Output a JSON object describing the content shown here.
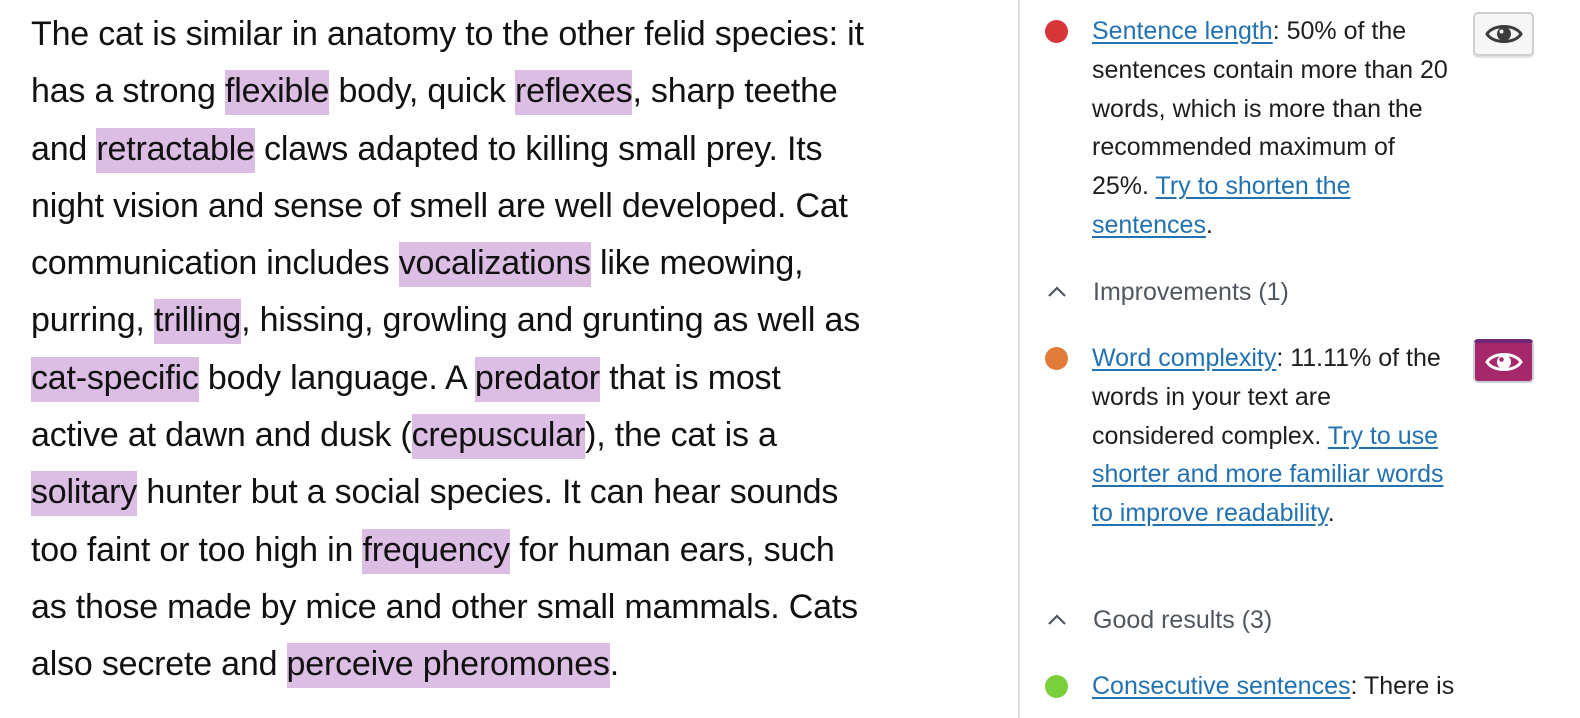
{
  "editor": {
    "highlight_color": "#dcbde4",
    "lines": [
      [
        {
          "t": "The cat is similar in anatomy to the other felid species: it",
          "h": false
        }
      ],
      [
        {
          "t": "has a strong ",
          "h": false
        },
        {
          "t": "flexible",
          "h": true
        },
        {
          "t": " body, quick ",
          "h": false
        },
        {
          "t": "reflexes",
          "h": true
        },
        {
          "t": ", sharp teethe",
          "h": false
        }
      ],
      [
        {
          "t": "and ",
          "h": false
        },
        {
          "t": "retractable",
          "h": true
        },
        {
          "t": " claws adapted to killing small prey. Its",
          "h": false
        }
      ],
      [
        {
          "t": "night vision and sense of smell are well developed. Cat",
          "h": false
        }
      ],
      [
        {
          "t": "communication includes ",
          "h": false
        },
        {
          "t": "vocalizations",
          "h": true
        },
        {
          "t": " like meowing,",
          "h": false
        }
      ],
      [
        {
          "t": "purring, ",
          "h": false
        },
        {
          "t": "trilling",
          "h": true
        },
        {
          "t": ", hissing, growling and grunting as well as",
          "h": false
        }
      ],
      [
        {
          "t": "cat-specific",
          "h": true
        },
        {
          "t": " body language. A ",
          "h": false
        },
        {
          "t": "predator",
          "h": true
        },
        {
          "t": " that is most",
          "h": false
        }
      ],
      [
        {
          "t": "active at dawn and dusk (",
          "h": false
        },
        {
          "t": "crepuscular",
          "h": true
        },
        {
          "t": "), the cat is a",
          "h": false
        }
      ],
      [
        {
          "t": "solitary",
          "h": true
        },
        {
          "t": " hunter but a social species. It can hear sounds",
          "h": false
        }
      ],
      [
        {
          "t": "too faint or too high in ",
          "h": false
        },
        {
          "t": "frequency",
          "h": true
        },
        {
          "t": " for human ears, such",
          "h": false
        }
      ],
      [
        {
          "t": "as those made by mice and other small mammals. Cats",
          "h": false
        }
      ],
      [
        {
          "t": "also secrete and ",
          "h": false
        },
        {
          "t": "perceive pheromones",
          "h": true
        },
        {
          "t": ".",
          "h": false
        }
      ]
    ]
  },
  "sidebar": {
    "problems": {
      "items": [
        {
          "status": "bad",
          "status_color": "#d63638",
          "link_label": "Sentence length",
          "text": ": 50% of the sentences contain more than 20 words, which is more than the recommended maximum of 25%. ",
          "action_label": "Try to shorten the sentences",
          "trailing": ".",
          "eye_icon": "eye-icon",
          "highlight_active": false
        }
      ]
    },
    "improvements": {
      "label": "Improvements (1)",
      "chevron_icon": "chevron-up-icon",
      "items": [
        {
          "status": "ok",
          "status_color": "#e07b39",
          "link_label": "Word complexity",
          "text": ": 11.11% of the words in your text are considered complex. ",
          "action_label": "Try to use shorter and more familiar words to improve readability",
          "trailing": ".",
          "eye_icon": "eye-icon",
          "highlight_active": true
        }
      ]
    },
    "good_results": {
      "label": "Good results (3)",
      "chevron_icon": "chevron-up-icon",
      "items": [
        {
          "status": "good",
          "status_color": "#7ad03a",
          "link_label": "Consecutive sentences",
          "text": ": There is"
        }
      ]
    },
    "active_button_color": "#a4286a",
    "link_color": "#2271b1"
  }
}
